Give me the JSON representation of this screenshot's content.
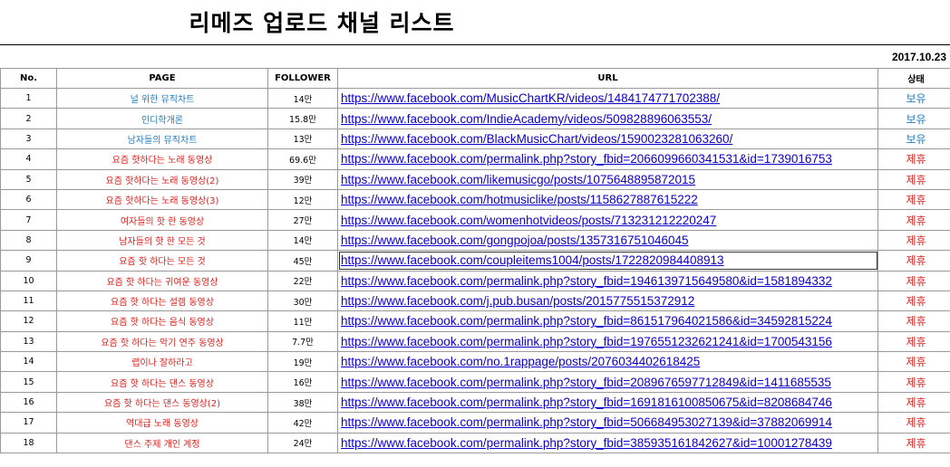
{
  "title": "리메즈 업로드 채널 리스트",
  "date": "2017.10.23",
  "colors": {
    "owned": "#1f7dc0",
    "partner": "#e0201c",
    "link": "#0b00cc"
  },
  "columns": {
    "no": "No.",
    "page": "PAGE",
    "follower": "FOLLOWER",
    "url": "URL",
    "status": "상태"
  },
  "rows": [
    {
      "no": "1",
      "page": "널 위한 뮤직차트",
      "follower": "14만",
      "url": "https://www.facebook.com/MusicChartKR/videos/1484174771702388/",
      "status": "보유",
      "kind": "owned"
    },
    {
      "no": "2",
      "page": "인디학개론",
      "follower": "15.8만",
      "url": "https://www.facebook.com/IndieAcademy/videos/509828896063553/",
      "status": "보유",
      "kind": "owned"
    },
    {
      "no": "3",
      "page": "남자들의 뮤직차트",
      "follower": "13만",
      "url": "https://www.facebook.com/BlackMusicChart/videos/1590023281063260/",
      "status": "보유",
      "kind": "owned"
    },
    {
      "no": "4",
      "page": "요즘 핫하다는 노래 동영상",
      "follower": "69.6만",
      "url": "https://www.facebook.com/permalink.php?story_fbid=2066099660341531&id=1739016753",
      "status": "제휴",
      "kind": "partner"
    },
    {
      "no": "5",
      "page": "요즘 핫하다는 노래 동영상(2)",
      "follower": "39만",
      "url": "https://www.facebook.com/likemusicgo/posts/1075648895872015",
      "status": "제휴",
      "kind": "partner"
    },
    {
      "no": "6",
      "page": "요즘 핫하다는 노래 동영상(3)",
      "follower": "12만",
      "url": "https://www.facebook.com/hotmusiclike/posts/1158627887615222",
      "status": "제휴",
      "kind": "partner"
    },
    {
      "no": "7",
      "page": "여자들의 핫 한 동영상",
      "follower": "27만",
      "url": "https://www.facebook.com/womenhotvideos/posts/713231212220247",
      "status": "제휴",
      "kind": "partner"
    },
    {
      "no": "8",
      "page": "남자들의 핫 한 모든 것",
      "follower": "14만",
      "url": "https://www.facebook.com/gongpojoa/posts/1357316751046045",
      "status": "제휴",
      "kind": "partner"
    },
    {
      "no": "9",
      "page": "요즘 핫 하다는 모든 것",
      "follower": "45만",
      "url": "https://www.facebook.com/coupleitems1004/posts/1722820984408913",
      "status": "제휴",
      "kind": "partner"
    },
    {
      "no": "10",
      "page": "요즘 핫 하다는 귀여운 동영상",
      "follower": "22만",
      "url": "https://www.facebook.com/permalink.php?story_fbid=1946139715649580&id=1581894332",
      "status": "제휴",
      "kind": "partner"
    },
    {
      "no": "11",
      "page": "요즘 핫 하다는 설렘 동영상",
      "follower": "30만",
      "url": "https://www.facebook.com/j.pub.busan/posts/2015775515372912",
      "status": "제휴",
      "kind": "partner"
    },
    {
      "no": "12",
      "page": "요즘 핫 하다는 음식 동영상",
      "follower": "11만",
      "url": "https://www.facebook.com/permalink.php?story_fbid=861517964021586&id=34592815224",
      "status": "제휴",
      "kind": "partner"
    },
    {
      "no": "13",
      "page": "요즘 핫 하다는 악기 연주 동영상",
      "follower": "7.7만",
      "url": "https://www.facebook.com/permalink.php?story_fbid=1976551232621241&id=1700543156",
      "status": "제휴",
      "kind": "partner"
    },
    {
      "no": "14",
      "page": "랩이나 잘하라고",
      "follower": "19만",
      "url": "https://www.facebook.com/no.1rappage/posts/2076034402618425",
      "status": "제휴",
      "kind": "partner"
    },
    {
      "no": "15",
      "page": "요즘 핫 하다는 댄스 동영상",
      "follower": "16만",
      "url": "https://www.facebook.com/permalink.php?story_fbid=2089676597712849&id=1411685535",
      "status": "제휴",
      "kind": "partner"
    },
    {
      "no": "16",
      "page": "요즘 핫 하다는 댄스 동영상(2)",
      "follower": "38만",
      "url": "https://www.facebook.com/permalink.php?story_fbid=1691816100850675&id=8208684746",
      "status": "제휴",
      "kind": "partner"
    },
    {
      "no": "17",
      "page": "역대급 노래 동영상",
      "follower": "42만",
      "url": "https://www.facebook.com/permalink.php?story_fbid=506684953027139&id=37882069914",
      "status": "제휴",
      "kind": "partner"
    },
    {
      "no": "18",
      "page": "댄스 주제 개인 계정",
      "follower": "24만",
      "url": "https://www.facebook.com/permalink.php?story_fbid=385935161842627&id=10001278439",
      "status": "제휴",
      "kind": "partner"
    }
  ]
}
